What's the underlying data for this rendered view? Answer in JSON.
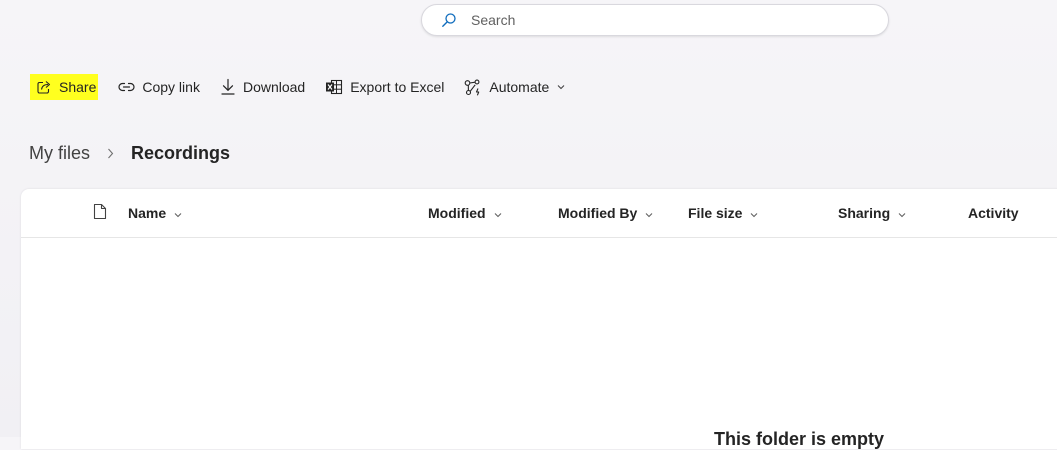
{
  "search": {
    "placeholder": "Search"
  },
  "toolbar": {
    "share": "Share",
    "copy_link": "Copy link",
    "download": "Download",
    "export": "Export to Excel",
    "automate": "Automate"
  },
  "breadcrumb": {
    "root": "My files",
    "current": "Recordings"
  },
  "columns": {
    "name": "Name",
    "modified": "Modified",
    "modified_by": "Modified By",
    "file_size": "File size",
    "sharing": "Sharing",
    "activity": "Activity"
  },
  "empty_message": "This folder is empty",
  "highlight_color": "#ffff1f",
  "accent_color": "#0f6cbd"
}
